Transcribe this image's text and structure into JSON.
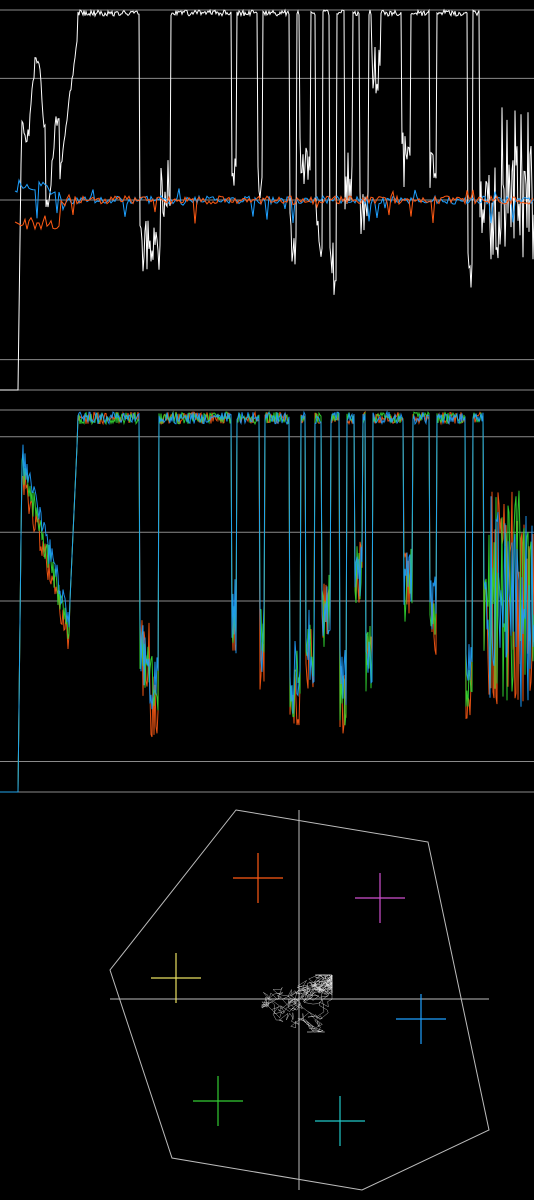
{
  "scopes": {
    "waveform": {
      "kind": "luma-chroma waveform",
      "colors": {
        "luma": "#ffffff",
        "cb": "#1ea0ff",
        "cr": "#ff5a14",
        "graticule": "#8a8a8a"
      },
      "graticule_levels": [
        0,
        0.08,
        0.5,
        0.82,
        1.0
      ]
    },
    "parade": {
      "kind": "rgb overlay waveform",
      "colors": {
        "r": "#ff5a14",
        "g": "#33dd33",
        "b": "#1ea0ff",
        "graticule": "#8a8a8a"
      },
      "graticule_levels": [
        0,
        0.08,
        0.5,
        0.68,
        0.93,
        1.0
      ]
    },
    "vectorscope": {
      "kind": "vectorscope",
      "colors": {
        "trace": "#e8e8e8",
        "outline": "#bcbcbc",
        "axis": "#bcbcbc"
      },
      "targets": [
        {
          "name": "red",
          "color": "#ff5a14"
        },
        {
          "name": "magenta",
          "color": "#d050d0"
        },
        {
          "name": "blue",
          "color": "#1ea0ff"
        },
        {
          "name": "cyan",
          "color": "#20c8c8"
        },
        {
          "name": "green",
          "color": "#33cc33"
        },
        {
          "name": "yellow",
          "color": "#e8e060"
        }
      ]
    }
  }
}
